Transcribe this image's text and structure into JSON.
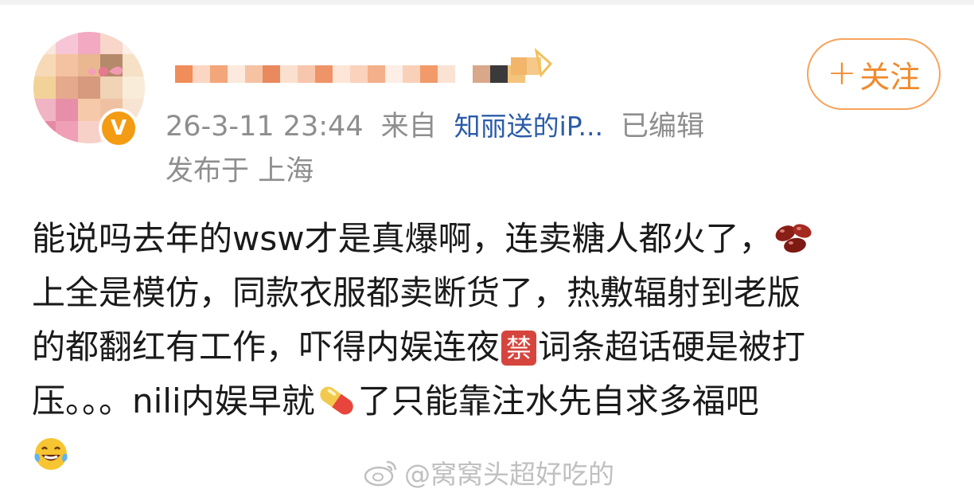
{
  "post": {
    "timestamp": "26-3-11 23:44",
    "source_prefix": "来自",
    "source_device": "知丽送的iP...",
    "edited": "已编辑",
    "location": "发布于 上海",
    "lines": [
      {
        "before": "能说吗去年的wsw才是真爆啊，连卖糖人都火了，",
        "emoji": "beans"
      },
      {
        "text": "上全是模仿，同款衣服都卖断货了，热敷辐射到老版"
      },
      {
        "before": "的都翻红有工作，吓得内娱连夜",
        "ban_glyph": "禁",
        "after": "词条超话硬是被打"
      },
      {
        "before": "压。。。nili内娱早就",
        "emoji": "pill",
        "after": "了只能靠注水先自求多福吧"
      },
      {
        "emoji": "laughing-tears"
      }
    ]
  },
  "follow_button": {
    "plus": "+",
    "label": "关注"
  },
  "watermark": {
    "text": "@窝窝头超好吃的"
  },
  "avatar": {
    "badge": "V"
  },
  "colors": {
    "accent_orange": "#f08a2c",
    "meta_gray": "#8e8e8e",
    "link_blue": "#2b5ba8",
    "badge_orange": "#f39b12",
    "ban_red": "#d6453d"
  }
}
